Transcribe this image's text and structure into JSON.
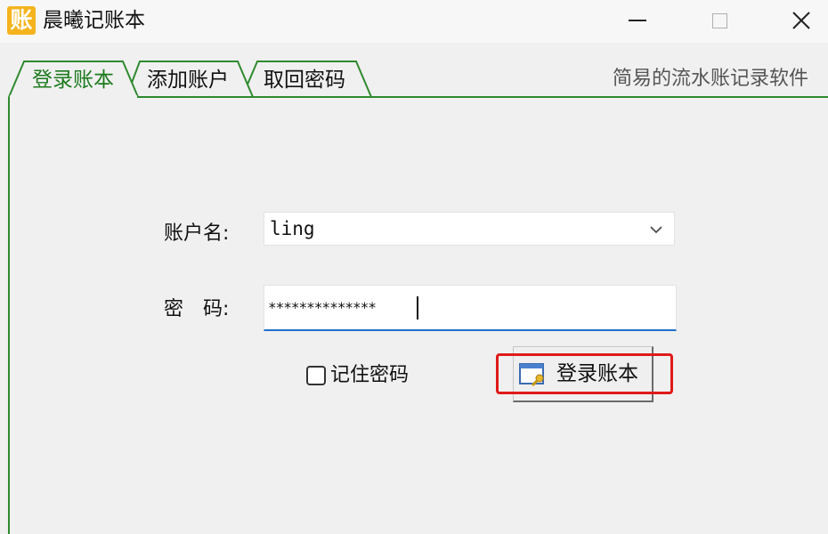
{
  "window": {
    "icon_glyph": "账",
    "title": "晨曦记账本",
    "controls": [
      "minimize",
      "maximize",
      "close"
    ]
  },
  "tabs": [
    {
      "label": "登录账本",
      "active": true
    },
    {
      "label": "添加账户",
      "active": false
    },
    {
      "label": "取回密码",
      "active": false
    }
  ],
  "tagline": "简易的流水账记录软件",
  "form": {
    "account_label": "账户名:",
    "account_value": "ling",
    "password_label": "密　码:",
    "password_value": "**************",
    "remember_label": "记住密码",
    "remember_checked": false,
    "login_button_label": "登录账本"
  },
  "colors": {
    "accent_green": "#2f8a2f",
    "active_tab_text": "#1d7a1d",
    "focus_blue": "#1f6fd0",
    "highlight_red": "#e01a1a",
    "app_icon": "#f5b41e"
  },
  "icons": {
    "app": "ledger-app-icon",
    "dropdown": "chevron-down-icon",
    "login": "window-key-icon"
  }
}
